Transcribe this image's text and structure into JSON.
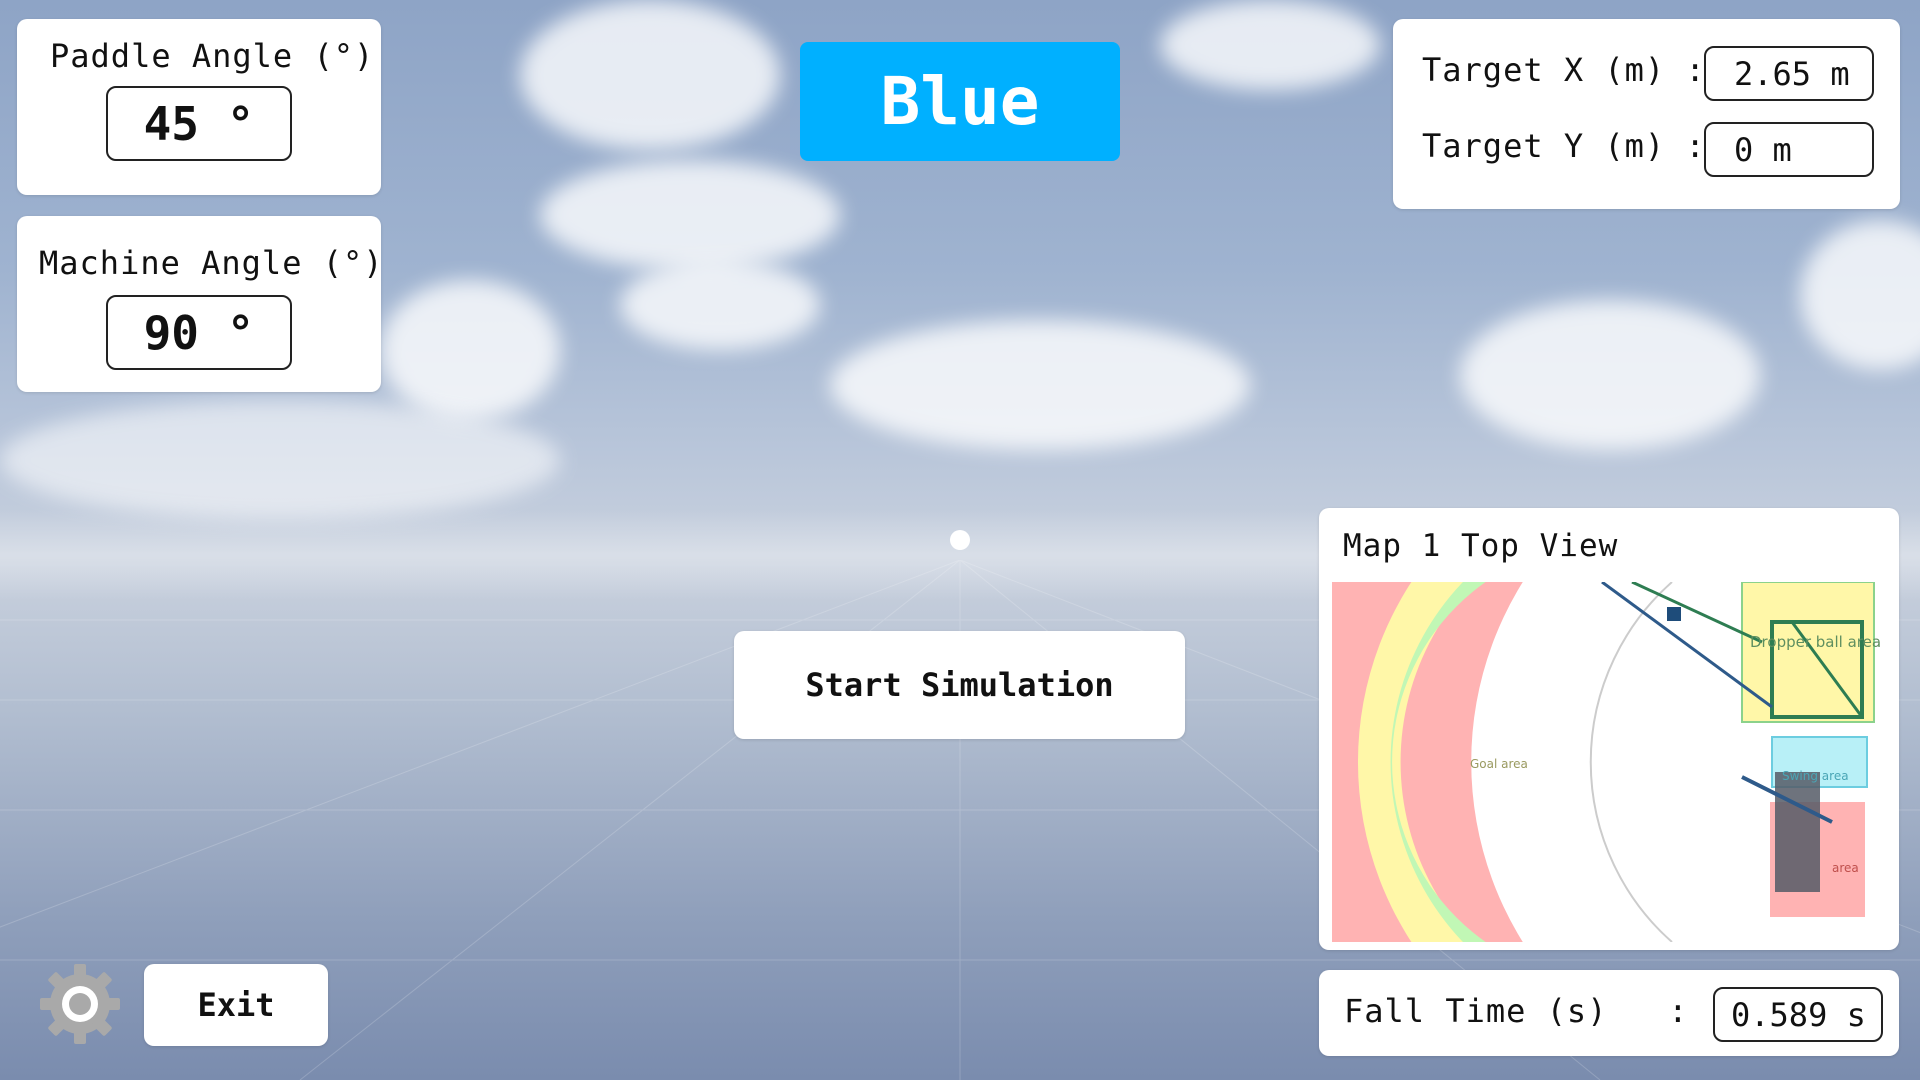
{
  "team_label": "Blue",
  "paddle_angle": {
    "label": "Paddle Angle (°)",
    "value": "45 °"
  },
  "machine_angle": {
    "label": "Machine Angle (°)",
    "value": "90 °"
  },
  "target": {
    "x_label": "Target X (m) :",
    "x_value": "2.65 m",
    "y_label": "Target Y (m) :",
    "y_value": "0 m"
  },
  "start_button": "Start Simulation",
  "exit_button": "Exit",
  "map": {
    "title": "Map 1 Top View",
    "zone_labels": {
      "goal": "Goal area",
      "dropper": "Dropper ball area",
      "swing": "Swing area",
      "red": "area"
    }
  },
  "fall_time": {
    "label": "Fall Time (s)   :",
    "value": "0.589 s"
  },
  "colors": {
    "accent": "#00b0ff",
    "zone_red": "#ffb3b3",
    "zone_yellow": "#fff7a8",
    "zone_green": "#c1f7b5",
    "zone_cyan": "#b8f0f7"
  },
  "icons": {
    "settings": "gear-icon"
  }
}
